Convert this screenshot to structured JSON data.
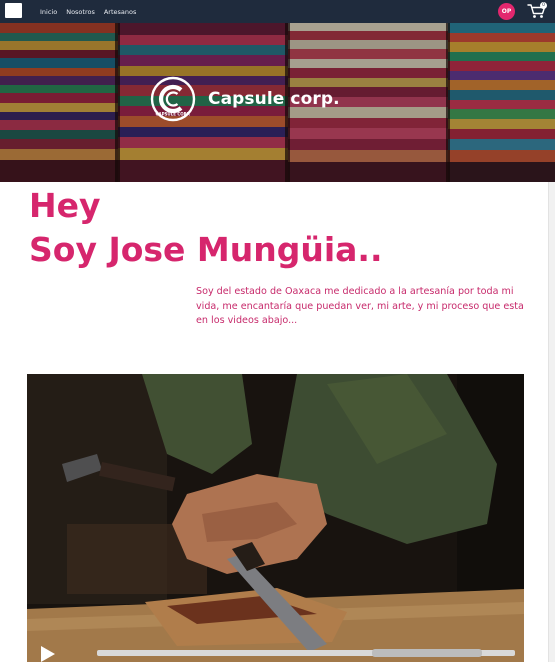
{
  "nav": {
    "links": [
      "Inicio",
      "Nosotros",
      "Artesanos"
    ],
    "user_initials": "OP",
    "cart_count": "0",
    "background": "#1f2b3d"
  },
  "hero": {
    "brand_name": "Capsule corp.",
    "logo_text": "CAPSULE CORP."
  },
  "content": {
    "greeting": "Hey",
    "name_line": "Soy Jose Mungüia..",
    "intro": "Soy del estado de Oaxaca me dedicado a la artesanía por toda mi vida, me encantaría que puedan ver, mi arte, y mi proceso que esta en los videos abajo...",
    "accent_color": "#d6266d"
  },
  "video": {
    "progress": 0
  },
  "icons": [
    "cart-icon",
    "play-icon",
    "capsule-logo-icon"
  ]
}
